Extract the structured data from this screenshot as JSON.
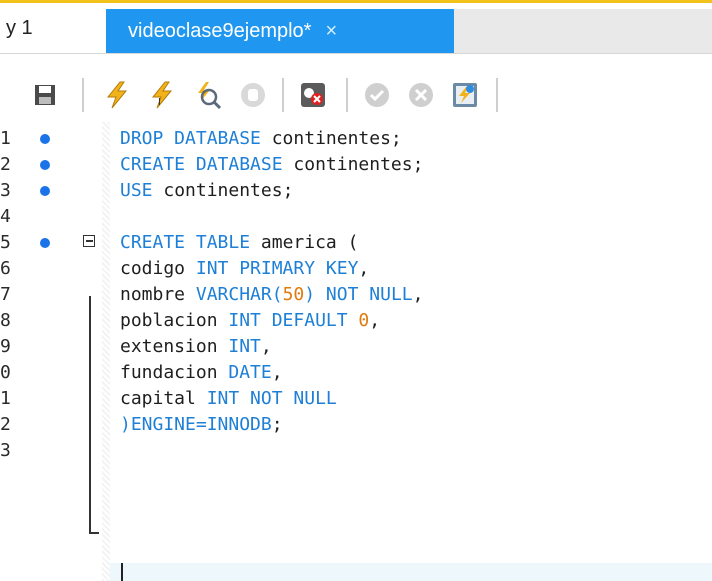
{
  "tabs": {
    "previous": "y 1",
    "active": "videoclase9ejemplo*",
    "close_glyph": "×"
  },
  "toolbar": {
    "icons": [
      "save-icon",
      "execute-icon",
      "execute-current-icon",
      "explain-icon",
      "stop-icon",
      "toggle-error-icon",
      "commit-icon",
      "rollback-icon",
      "autocommit-icon"
    ]
  },
  "editor": {
    "lines": [
      {
        "n": "1",
        "bp": true,
        "code": [
          [
            "kw",
            "DROP DATABASE "
          ],
          [
            "id",
            "continentes;"
          ]
        ]
      },
      {
        "n": "2",
        "bp": true,
        "code": [
          [
            "kw",
            "CREATE DATABASE "
          ],
          [
            "id",
            "continentes;"
          ]
        ]
      },
      {
        "n": "3",
        "bp": true,
        "code": [
          [
            "kw",
            "USE "
          ],
          [
            "id",
            "continentes;"
          ]
        ]
      },
      {
        "n": "4",
        "bp": false,
        "code": []
      },
      {
        "n": "5",
        "bp": true,
        "fold": true,
        "code": [
          [
            "kw",
            "CREATE TABLE "
          ],
          [
            "id",
            "america ("
          ]
        ]
      },
      {
        "n": "6",
        "bp": false,
        "code": [
          [
            "id",
            "codigo "
          ],
          [
            "kw",
            "INT PRIMARY KEY"
          ],
          [
            "id",
            ","
          ]
        ]
      },
      {
        "n": "7",
        "bp": false,
        "code": [
          [
            "id",
            "nombre "
          ],
          [
            "kw",
            "VARCHAR("
          ],
          [
            "num",
            "50"
          ],
          [
            "kw",
            ") NOT NULL"
          ],
          [
            "id",
            ","
          ]
        ]
      },
      {
        "n": "8",
        "bp": false,
        "code": [
          [
            "id",
            "poblacion "
          ],
          [
            "kw",
            "INT DEFAULT "
          ],
          [
            "num",
            "0"
          ],
          [
            "id",
            ","
          ]
        ]
      },
      {
        "n": "9",
        "bp": false,
        "code": [
          [
            "id",
            "extension "
          ],
          [
            "kw",
            "INT"
          ],
          [
            "id",
            ","
          ]
        ]
      },
      {
        "n": "0",
        "bp": false,
        "code": [
          [
            "id",
            "fundacion "
          ],
          [
            "kw",
            "DATE"
          ],
          [
            "id",
            ","
          ]
        ]
      },
      {
        "n": "1",
        "bp": false,
        "code": [
          [
            "id",
            "capital "
          ],
          [
            "kw",
            "INT NOT NULL"
          ]
        ]
      },
      {
        "n": "2",
        "bp": false,
        "code": [
          [
            "kw",
            ")ENGINE=INNODB"
          ],
          [
            "id",
            ";"
          ]
        ]
      },
      {
        "n": "3",
        "bp": false,
        "code": []
      }
    ]
  },
  "colors": {
    "accent": "#1f97f0",
    "keyword": "#1e7fd6",
    "number": "#e07b10",
    "breakpoint": "#1a73e8"
  }
}
